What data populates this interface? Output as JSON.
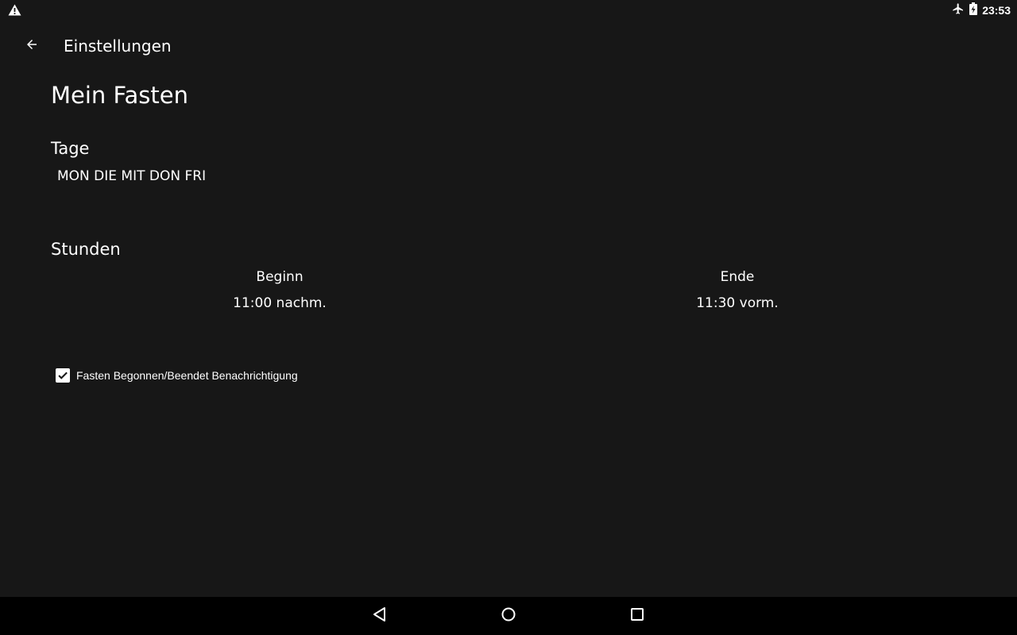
{
  "status_bar": {
    "time": "23:53",
    "icons": [
      "warning-icon",
      "airplane-mode-icon",
      "battery-charging-icon"
    ]
  },
  "app_bar": {
    "title": "Einstellungen",
    "back_icon": "arrow-back-icon"
  },
  "content": {
    "page_title": "Mein Fasten",
    "days_section": {
      "heading": "Tage",
      "value": "MON DIE MIT DON FRI"
    },
    "hours_section": {
      "heading": "Stunden",
      "begin_label": "Beginn",
      "begin_value": "11:00 nachm.",
      "end_label": "Ende",
      "end_value": "11:30 vorm."
    },
    "notification": {
      "label": "Fasten Begonnen/Beendet Benachrichtigung",
      "checked": true
    }
  },
  "nav_bar": {
    "buttons": [
      "nav-back-icon",
      "nav-home-icon",
      "nav-recents-icon"
    ]
  },
  "colors": {
    "background": "#171717",
    "text": "#ffffff",
    "nav_background": "#000000"
  }
}
